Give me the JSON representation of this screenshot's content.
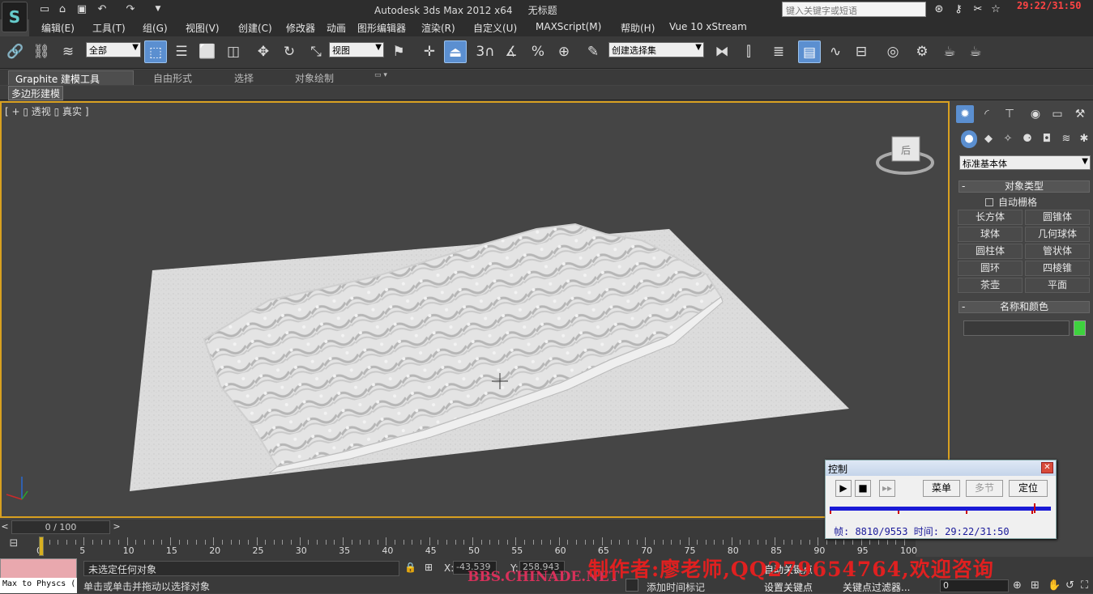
{
  "titlebar": {
    "title": "Autodesk 3ds Max  2012 x64",
    "doc": "无标题",
    "search_placeholder": "键入关键字或短语",
    "clock": "29:22/31:50"
  },
  "menu": [
    "编辑(E)",
    "工具(T)",
    "组(G)",
    "视图(V)",
    "创建(C)",
    "修改器",
    "动画",
    "图形编辑器",
    "渲染(R)",
    "自定义(U)",
    "MAXScript(M)",
    "帮助(H)",
    "Vue 10 xStream"
  ],
  "toolbar": {
    "selection_filter": "全部",
    "ref_coord": "视图",
    "named_selection": "创建选择集",
    "snap_label": "3"
  },
  "ribbon": {
    "tabs": [
      "Graphite 建模工具",
      "自由形式",
      "选择",
      "对象绘制"
    ],
    "subtab": "多边形建模"
  },
  "viewport": {
    "label": "[ + ▯ 透视 ▯ 真实 ]",
    "viewcube_face": "后"
  },
  "command_panel": {
    "category": "标准基本体",
    "object_type_title": "对象类型",
    "autogrid": "自动栅格",
    "buttons": [
      "长方体",
      "圆锥体",
      "球体",
      "几何球体",
      "圆柱体",
      "管状体",
      "圆环",
      "四棱锥",
      "茶壶",
      "平面"
    ],
    "name_color_title": "名称和颜色",
    "object_color": "#3ed23e"
  },
  "timeline": {
    "position": "0 / 100",
    "ticks": [
      "0",
      "5",
      "10",
      "15",
      "20",
      "25",
      "30",
      "35",
      "40",
      "45",
      "50",
      "55",
      "60",
      "65",
      "70",
      "75",
      "80",
      "85",
      "90",
      "95",
      "100"
    ]
  },
  "status": {
    "maxscript_output": "Max to Physcs (",
    "selection_msg": "未选定任何对象",
    "prompt_msg": "单击或单击并拖动以选择对象",
    "x_label": "X:",
    "x_value": "-43.539",
    "y_label": "Y:",
    "y_value": "258.943",
    "add_time_tag": "添加时间标记",
    "auto_key": "自动关键点",
    "set_key": "设置关键点",
    "key_filters": "关键点过滤器...",
    "frame": "0"
  },
  "watermark": {
    "main": "制作者:廖老师,QQ279654764,欢迎咨询",
    "site": "BBS.CHINADE.NET"
  },
  "control_window": {
    "title": "控制",
    "menu": "菜单",
    "multi": "多节",
    "locate": "定位",
    "info": "帧: 8810/9553 时间: 29:22/31:50",
    "progress": 0.922
  }
}
